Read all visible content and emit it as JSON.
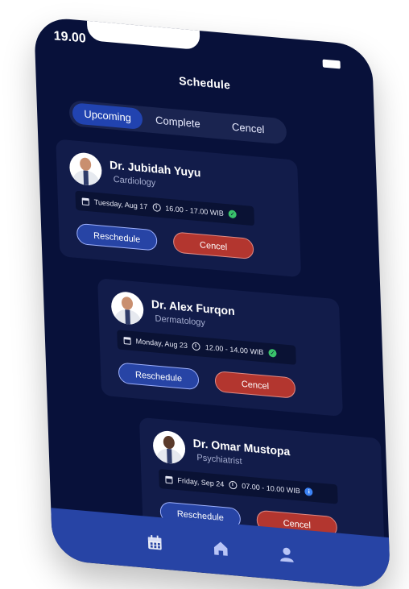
{
  "status": {
    "time": "19.00"
  },
  "header": {
    "title": "Schedule"
  },
  "tabs": [
    {
      "label": "Upcoming",
      "active": true
    },
    {
      "label": "Complete",
      "active": false
    },
    {
      "label": "Cencel",
      "active": false
    }
  ],
  "appointments": [
    {
      "doctor": "Dr. Jubidah Yuyu",
      "specialty": "Cardiology",
      "date": "Tuesday, Aug 17",
      "time": "16.00 - 17.00 WIB",
      "status_icon": "check-icon",
      "reschedule_label": "Reschedule",
      "cancel_label": "Cencel"
    },
    {
      "doctor": "Dr. Alex Furqon",
      "specialty": "Dermatology",
      "date": "Monday, Aug 23",
      "time": "12.00 - 14.00 WIB",
      "status_icon": "check-icon",
      "reschedule_label": "Reschedule",
      "cancel_label": "Cencel"
    },
    {
      "doctor": "Dr. Omar Mustopa",
      "specialty": "Psychiatrist",
      "date": "Friday, Sep 24",
      "time": "07.00 - 10.00 WIB",
      "status_icon": "info-icon",
      "reschedule_label": "Reschedule",
      "cancel_label": "Cencel"
    }
  ],
  "bottom_nav": {
    "items": [
      "calendar-icon",
      "home-icon",
      "profile-icon"
    ],
    "active": "calendar-icon"
  },
  "colors": {
    "background": "#08113a",
    "card": "#121c4a",
    "accent": "#2744a5",
    "danger": "#b3362f",
    "success": "#39c26b"
  }
}
